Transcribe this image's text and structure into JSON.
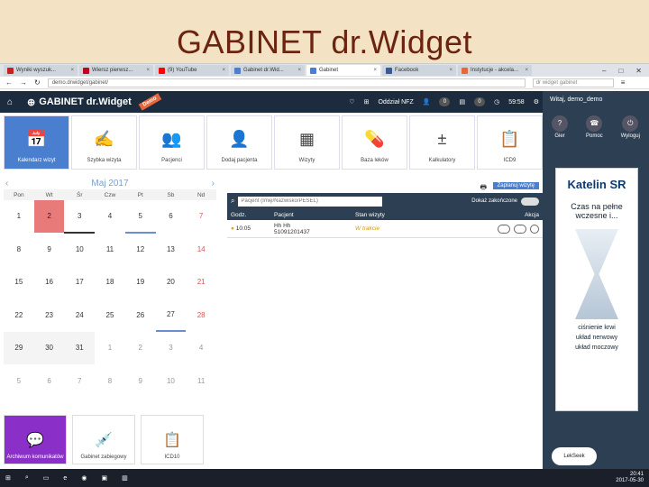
{
  "slide_title": "GABINET dr.Widget",
  "tabs": [
    {
      "label": "Wyniki wyszuk...",
      "icon": "gmail-icon",
      "color": "#c5221f"
    },
    {
      "label": "Wiersz pierwsz...",
      "icon": "pinterest-icon",
      "color": "#bd081c"
    },
    {
      "label": "(9) YouTube",
      "icon": "youtube-icon",
      "color": "#ff0000"
    },
    {
      "label": "Gabinet dr.Wid...",
      "icon": "page-icon",
      "color": "#4a7fd0"
    },
    {
      "label": "Gabinet",
      "icon": "page-icon",
      "color": "#4a7fd0",
      "active": true
    },
    {
      "label": "Facebook",
      "icon": "facebook-icon",
      "color": "#3b5998"
    },
    {
      "label": "Instytucje - akcela...",
      "icon": "page-icon",
      "color": "#e8663a"
    }
  ],
  "address": "demo.drwidget/gabinet/",
  "search_placeholder": "dr widget gabinet",
  "app": {
    "logo": "GABINET dr.Widget",
    "demo_label": "Demo",
    "clinic": "Oddział NFZ",
    "badge1": "0",
    "badge2": "0",
    "timer": "59:58"
  },
  "side": {
    "user": "Witaj, demo_demo",
    "icons": [
      {
        "label": "Gier",
        "icon": "help-icon"
      },
      {
        "label": "Pomoc",
        "icon": "support-icon"
      },
      {
        "label": "Wyloguj",
        "icon": "logout-icon"
      }
    ]
  },
  "tiles": [
    {
      "label": "Kalendarz wizyt",
      "icon": "calendar-icon",
      "active": true
    },
    {
      "label": "Szybka wizyta",
      "icon": "quick-visit-icon"
    },
    {
      "label": "Pacjenci",
      "icon": "patients-icon"
    },
    {
      "label": "Dodaj pacjenta",
      "icon": "add-patient-icon"
    },
    {
      "label": "Wizyty",
      "icon": "visits-icon"
    },
    {
      "label": "Baza leków",
      "icon": "medicine-icon"
    },
    {
      "label": "Kalkulatory",
      "icon": "calculator-icon"
    },
    {
      "label": "ICD9",
      "icon": "clipboard-icon"
    }
  ],
  "calendar": {
    "month": "Maj 2017",
    "weekdays": [
      "Pon",
      "Wt",
      "Śr",
      "Czw",
      "Pt",
      "Sb",
      "Nd"
    ],
    "days": [
      [
        "1",
        "2",
        "3",
        "4",
        "5",
        "6",
        "7"
      ],
      [
        "8",
        "9",
        "10",
        "11",
        "12",
        "13",
        "14"
      ],
      [
        "15",
        "16",
        "17",
        "18",
        "19",
        "20",
        "21"
      ],
      [
        "22",
        "23",
        "24",
        "25",
        "26",
        "27",
        "28"
      ],
      [
        "29",
        "30",
        "31",
        "1",
        "2",
        "3",
        "4"
      ],
      [
        "5",
        "6",
        "7",
        "8",
        "9",
        "10",
        "11"
      ]
    ]
  },
  "bottom_tiles": [
    {
      "label": "Archiwum komunikatów",
      "icon": "chat-icon",
      "purple": true
    },
    {
      "label": "Gabinet zabiegowy",
      "icon": "syringe-icon"
    },
    {
      "label": "ICD10",
      "icon": "clipboard-icon"
    }
  ],
  "visits": {
    "add_label": "Zaplanuj wizytę",
    "search_placeholder": "Pacjent (Imię/Nazwisko/PESEL)",
    "toggle_label": "Dokaż zakończone",
    "headers": [
      "Godz.",
      "Pacjent",
      "Stan wizyty",
      "Akcja"
    ],
    "rows": [
      {
        "time": "10:05",
        "patient": "Hh Hh",
        "pesel": "51091201437",
        "status": "W trakcie"
      }
    ]
  },
  "ad": {
    "brand": "Katelin SR",
    "headline": "Czas na pełne wczesne i...",
    "lines": [
      "ciśnienie krwi",
      "układ nerwowy",
      "układ moczowy"
    ],
    "company": "LekSeek"
  },
  "taskbar": {
    "time": "20:41",
    "date": "2017-05-30"
  }
}
